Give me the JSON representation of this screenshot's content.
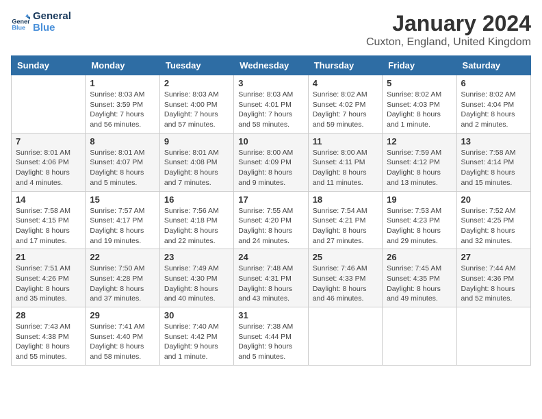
{
  "logo": {
    "line1": "General",
    "line2": "Blue"
  },
  "title": "January 2024",
  "subtitle": "Cuxton, England, United Kingdom",
  "days_of_week": [
    "Sunday",
    "Monday",
    "Tuesday",
    "Wednesday",
    "Thursday",
    "Friday",
    "Saturday"
  ],
  "weeks": [
    [
      {
        "day": "",
        "info": ""
      },
      {
        "day": "1",
        "info": "Sunrise: 8:03 AM\nSunset: 3:59 PM\nDaylight: 7 hours\nand 56 minutes."
      },
      {
        "day": "2",
        "info": "Sunrise: 8:03 AM\nSunset: 4:00 PM\nDaylight: 7 hours\nand 57 minutes."
      },
      {
        "day": "3",
        "info": "Sunrise: 8:03 AM\nSunset: 4:01 PM\nDaylight: 7 hours\nand 58 minutes."
      },
      {
        "day": "4",
        "info": "Sunrise: 8:02 AM\nSunset: 4:02 PM\nDaylight: 7 hours\nand 59 minutes."
      },
      {
        "day": "5",
        "info": "Sunrise: 8:02 AM\nSunset: 4:03 PM\nDaylight: 8 hours\nand 1 minute."
      },
      {
        "day": "6",
        "info": "Sunrise: 8:02 AM\nSunset: 4:04 PM\nDaylight: 8 hours\nand 2 minutes."
      }
    ],
    [
      {
        "day": "7",
        "info": "Sunrise: 8:01 AM\nSunset: 4:06 PM\nDaylight: 8 hours\nand 4 minutes."
      },
      {
        "day": "8",
        "info": "Sunrise: 8:01 AM\nSunset: 4:07 PM\nDaylight: 8 hours\nand 5 minutes."
      },
      {
        "day": "9",
        "info": "Sunrise: 8:01 AM\nSunset: 4:08 PM\nDaylight: 8 hours\nand 7 minutes."
      },
      {
        "day": "10",
        "info": "Sunrise: 8:00 AM\nSunset: 4:09 PM\nDaylight: 8 hours\nand 9 minutes."
      },
      {
        "day": "11",
        "info": "Sunrise: 8:00 AM\nSunset: 4:11 PM\nDaylight: 8 hours\nand 11 minutes."
      },
      {
        "day": "12",
        "info": "Sunrise: 7:59 AM\nSunset: 4:12 PM\nDaylight: 8 hours\nand 13 minutes."
      },
      {
        "day": "13",
        "info": "Sunrise: 7:58 AM\nSunset: 4:14 PM\nDaylight: 8 hours\nand 15 minutes."
      }
    ],
    [
      {
        "day": "14",
        "info": "Sunrise: 7:58 AM\nSunset: 4:15 PM\nDaylight: 8 hours\nand 17 minutes."
      },
      {
        "day": "15",
        "info": "Sunrise: 7:57 AM\nSunset: 4:17 PM\nDaylight: 8 hours\nand 19 minutes."
      },
      {
        "day": "16",
        "info": "Sunrise: 7:56 AM\nSunset: 4:18 PM\nDaylight: 8 hours\nand 22 minutes."
      },
      {
        "day": "17",
        "info": "Sunrise: 7:55 AM\nSunset: 4:20 PM\nDaylight: 8 hours\nand 24 minutes."
      },
      {
        "day": "18",
        "info": "Sunrise: 7:54 AM\nSunset: 4:21 PM\nDaylight: 8 hours\nand 27 minutes."
      },
      {
        "day": "19",
        "info": "Sunrise: 7:53 AM\nSunset: 4:23 PM\nDaylight: 8 hours\nand 29 minutes."
      },
      {
        "day": "20",
        "info": "Sunrise: 7:52 AM\nSunset: 4:25 PM\nDaylight: 8 hours\nand 32 minutes."
      }
    ],
    [
      {
        "day": "21",
        "info": "Sunrise: 7:51 AM\nSunset: 4:26 PM\nDaylight: 8 hours\nand 35 minutes."
      },
      {
        "day": "22",
        "info": "Sunrise: 7:50 AM\nSunset: 4:28 PM\nDaylight: 8 hours\nand 37 minutes."
      },
      {
        "day": "23",
        "info": "Sunrise: 7:49 AM\nSunset: 4:30 PM\nDaylight: 8 hours\nand 40 minutes."
      },
      {
        "day": "24",
        "info": "Sunrise: 7:48 AM\nSunset: 4:31 PM\nDaylight: 8 hours\nand 43 minutes."
      },
      {
        "day": "25",
        "info": "Sunrise: 7:46 AM\nSunset: 4:33 PM\nDaylight: 8 hours\nand 46 minutes."
      },
      {
        "day": "26",
        "info": "Sunrise: 7:45 AM\nSunset: 4:35 PM\nDaylight: 8 hours\nand 49 minutes."
      },
      {
        "day": "27",
        "info": "Sunrise: 7:44 AM\nSunset: 4:36 PM\nDaylight: 8 hours\nand 52 minutes."
      }
    ],
    [
      {
        "day": "28",
        "info": "Sunrise: 7:43 AM\nSunset: 4:38 PM\nDaylight: 8 hours\nand 55 minutes."
      },
      {
        "day": "29",
        "info": "Sunrise: 7:41 AM\nSunset: 4:40 PM\nDaylight: 8 hours\nand 58 minutes."
      },
      {
        "day": "30",
        "info": "Sunrise: 7:40 AM\nSunset: 4:42 PM\nDaylight: 9 hours\nand 1 minute."
      },
      {
        "day": "31",
        "info": "Sunrise: 7:38 AM\nSunset: 4:44 PM\nDaylight: 9 hours\nand 5 minutes."
      },
      {
        "day": "",
        "info": ""
      },
      {
        "day": "",
        "info": ""
      },
      {
        "day": "",
        "info": ""
      }
    ]
  ]
}
